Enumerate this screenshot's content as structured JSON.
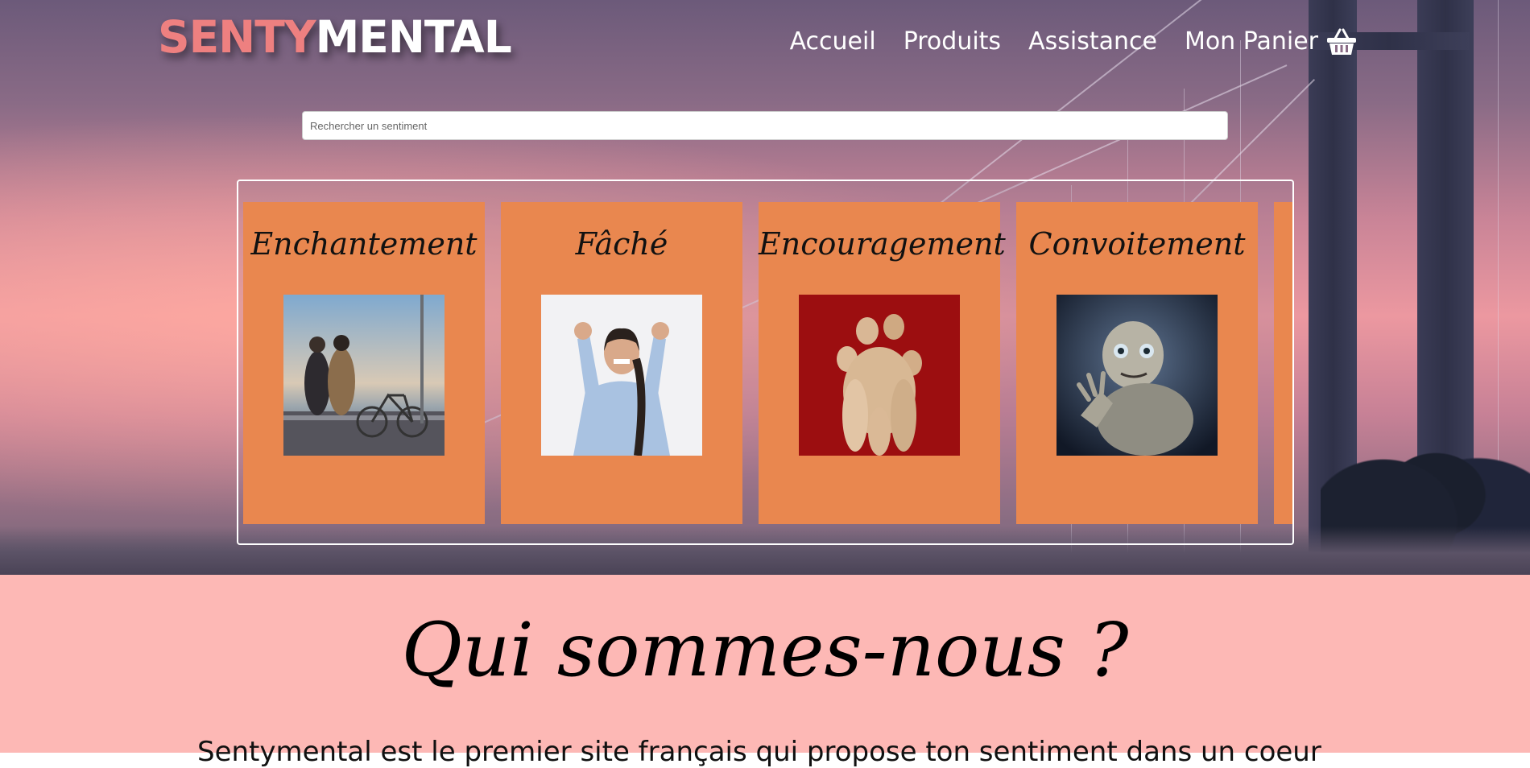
{
  "header": {
    "logo_part1": "SENTY",
    "logo_part2": "MENTAL",
    "nav": {
      "home": "Accueil",
      "products": "Produits",
      "support": "Assistance",
      "cart": "Mon Panier"
    },
    "cart_icon": "basket-icon"
  },
  "search": {
    "placeholder": "Rechercher un sentiment",
    "value": ""
  },
  "carousel": {
    "cards": [
      {
        "title": "Enchantement",
        "image": "couple-with-bicycle-photo"
      },
      {
        "title": "Fâché",
        "image": "angry-woman-photo"
      },
      {
        "title": "Encouragement",
        "image": "wooden-mannequins-photo"
      },
      {
        "title": "Convoitement",
        "image": "gollum-photo"
      }
    ]
  },
  "about": {
    "heading": "Qui sommes-nous ?",
    "text": "Sentymental est le premier site français qui propose ton sentiment dans un coeur"
  },
  "colors": {
    "logo_accent": "#ee8080",
    "card_bg": "#e9874f",
    "about_bg": "#fdb8b5"
  }
}
